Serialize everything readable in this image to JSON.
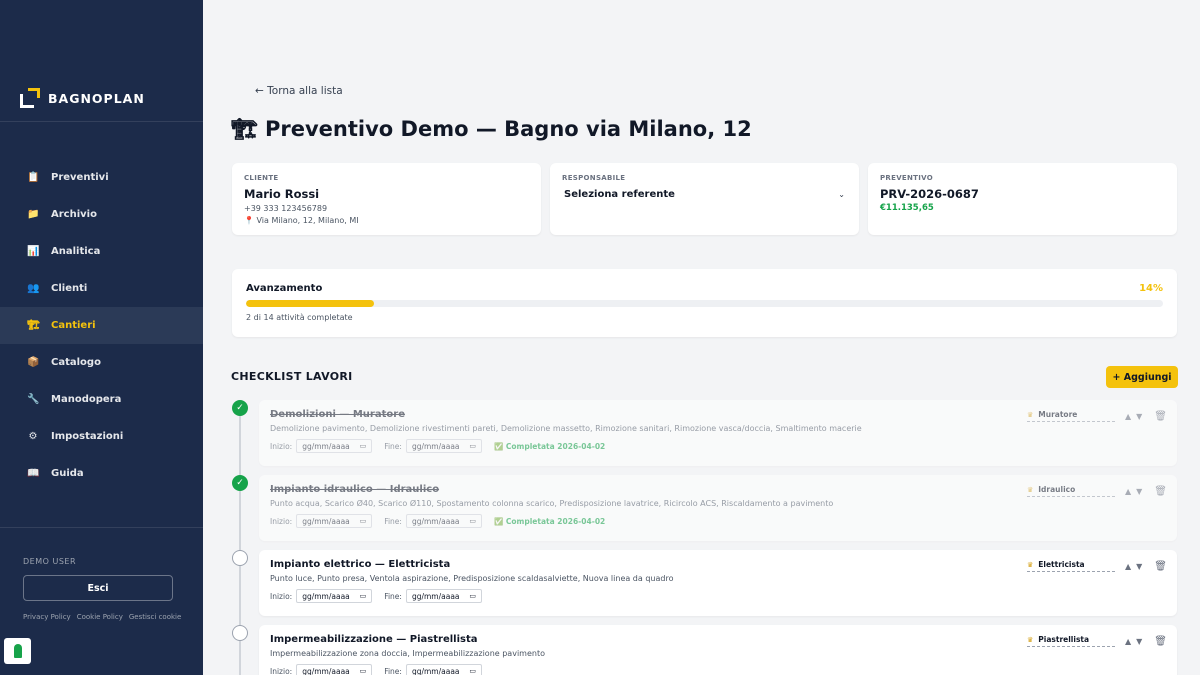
{
  "sidebar": {
    "brand": "BAGNOPLAN",
    "items": [
      {
        "label": "Preventivi",
        "icon": "clipboard-icon",
        "glyph": "📋"
      },
      {
        "label": "Archivio",
        "icon": "folder-icon",
        "glyph": "📁"
      },
      {
        "label": "Analitica",
        "icon": "chart-icon",
        "glyph": "📊"
      },
      {
        "label": "Clienti",
        "icon": "users-icon",
        "glyph": "👥"
      },
      {
        "label": "Cantieri",
        "icon": "crane-icon",
        "glyph": "🏗"
      },
      {
        "label": "Catalogo",
        "icon": "box-icon",
        "glyph": "📦"
      },
      {
        "label": "Manodopera",
        "icon": "wrench-icon",
        "glyph": "🔧"
      },
      {
        "label": "Impostazioni",
        "icon": "gear-icon",
        "glyph": "⚙"
      },
      {
        "label": "Guida",
        "icon": "book-icon",
        "glyph": "📖"
      }
    ],
    "active_item": "Cantieri",
    "user_label": "DEMO USER",
    "logout_label": "Esci",
    "links": [
      "Privacy Policy",
      "Cookie Policy",
      "Gestisci cookie"
    ]
  },
  "header": {
    "back_label": "← Torna alla lista",
    "title_icon": "🏗",
    "title": "Preventivo Demo — Bagno via Milano, 12"
  },
  "cards": {
    "client": {
      "label": "CLIENTE",
      "name": "Mario Rossi",
      "phone": "+39 333 123456789",
      "address": "📍 Via Milano, 12, Milano, MI"
    },
    "manager": {
      "label": "RESPONSABILE",
      "value": "Seleziona referente"
    },
    "quote": {
      "label": "PREVENTIVO",
      "number": "PRV-2026-0687",
      "amount": "€11.135,65"
    }
  },
  "progress": {
    "title": "Avanzamento",
    "percent_label": "14%",
    "fraction": 0.14,
    "subtitle": "2 di 14 attività completate"
  },
  "checklist": {
    "title": "CHECKLIST LAVORI",
    "add_label": "+ Aggiungi",
    "start_label": "Inizio:",
    "end_label": "Fine:",
    "date_placeholder": "gg/mm/aaaa",
    "tasks": [
      {
        "title": "Demolizioni — Muratore",
        "desc": "Demolizione pavimento, Demolizione rivestimenti pareti, Demolizione massetto, Rimozione sanitari, Rimozione vasca/doccia, Smaltimento macerie",
        "worker": "Muratore",
        "done": true,
        "done_label": "✅ Completata 2026-04-02"
      },
      {
        "title": "Impianto idraulico — Idraulico",
        "desc": "Punto acqua, Scarico Ø40, Scarico Ø110, Spostamento colonna scarico, Predisposizione lavatrice, Ricircolo ACS, Riscaldamento a pavimento",
        "worker": "Idraulico",
        "done": true,
        "done_label": "✅ Completata 2026-04-02"
      },
      {
        "title": "Impianto elettrico — Elettricista",
        "desc": "Punto luce, Punto presa, Ventola aspirazione, Predisposizione scaldasalviette, Nuova linea da quadro",
        "worker": "Elettricista",
        "done": false,
        "done_label": ""
      },
      {
        "title": "Impermeabilizzazione — Piastrellista",
        "desc": "Impermeabilizzazione zona doccia, Impermeabilizzazione pavimento",
        "worker": "Piastrellista",
        "done": false,
        "done_label": ""
      }
    ]
  }
}
